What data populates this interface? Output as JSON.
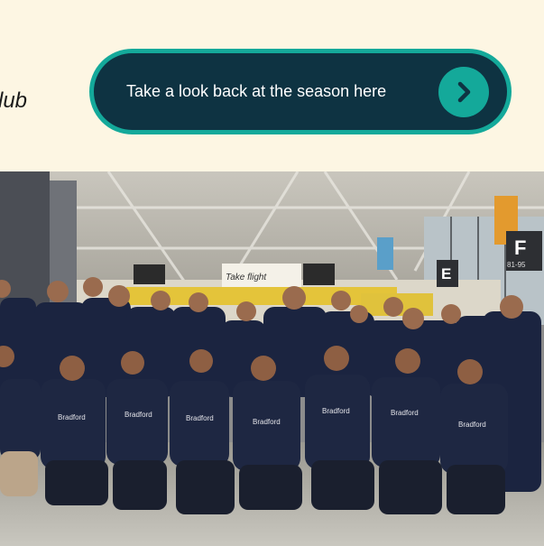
{
  "intro": {
    "trailing_text": "lub"
  },
  "cta": {
    "label": "Take a look back at the season here",
    "icon": "chevron-right-icon",
    "colors": {
      "background": "#0e3342",
      "border": "#14a99a",
      "arrow_circle": "#14a99a",
      "text": "#ffffff"
    }
  },
  "photo": {
    "signs": {
      "gate_e": "E",
      "gate_f": "F",
      "gate_f_range": "81-95",
      "banner": "Take flight"
    },
    "shirt_text": "Bradford"
  },
  "colors": {
    "page_background": "#fdf6e3"
  }
}
